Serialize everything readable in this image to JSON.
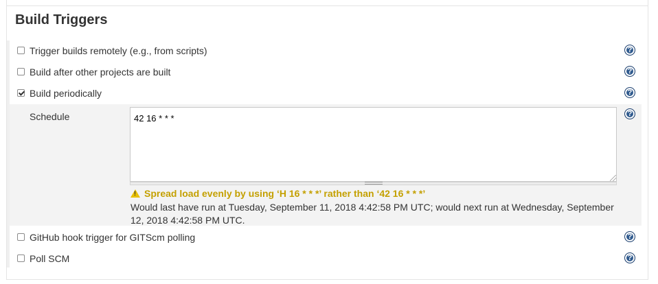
{
  "section": {
    "title": "Build Triggers"
  },
  "triggers": [
    {
      "label": "Trigger builds remotely (e.g., from scripts)",
      "checked": false
    },
    {
      "label": "Build after other projects are built",
      "checked": false
    },
    {
      "label": "Build periodically",
      "checked": true
    },
    {
      "label": "GitHub hook trigger for GITScm polling",
      "checked": false
    },
    {
      "label": "Poll SCM",
      "checked": false
    }
  ],
  "schedule": {
    "label": "Schedule",
    "value": "42 16 * * *",
    "warning": "Spread load evenly by using ‘H 16 * * *’ rather than ‘42 16 * * *’",
    "info": "Would last have run at Tuesday, September 11, 2018 4:42:58 PM UTC; would next run at Wednesday, September 12, 2018 4:42:58 PM UTC."
  },
  "help_icon": {
    "glyph": "?",
    "icon": "help-icon"
  },
  "colors": {
    "help_blue": "#2f5a8e",
    "warning": "#c4a000",
    "panel_bg": "#f3f3f3"
  }
}
